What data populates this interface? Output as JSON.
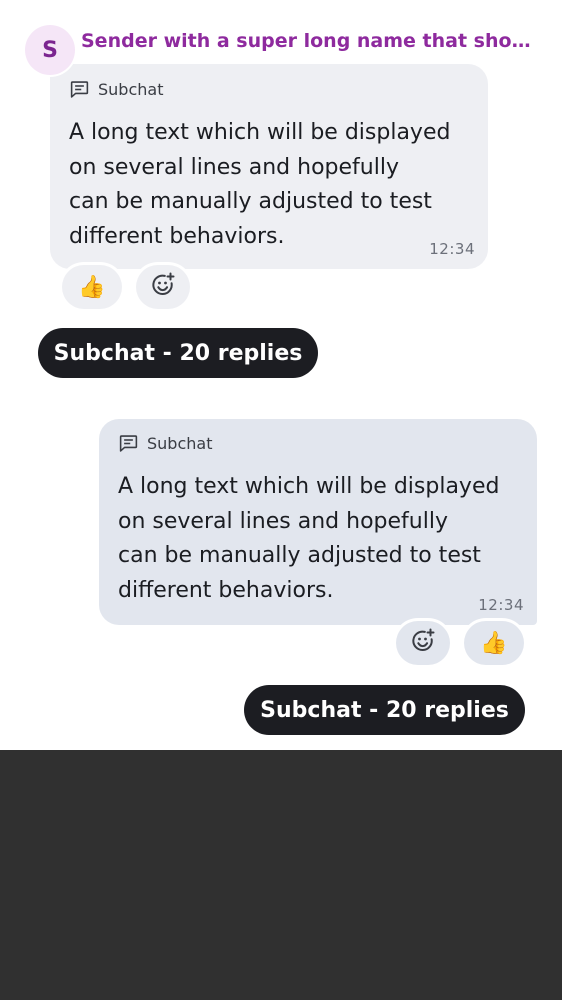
{
  "incoming": {
    "avatar_letter": "S",
    "sender_name": "Sender with a super long name that should overflow the available width",
    "thread_label": "Subchat",
    "text": "A long text which will be displayed\non several lines and hopefully\ncan be manually adjusted to test\ndifferent behaviors.",
    "time": "12:34",
    "reaction_emoji": "👍",
    "add_reaction_icon": "add-reaction-icon",
    "subchat_summary": "Subchat - 20 replies"
  },
  "outgoing": {
    "thread_label": "Subchat",
    "text": "A long text which will be displayed\non several lines and hopefully\ncan be manually adjusted to test\ndifferent behaviors.",
    "time": "12:34",
    "reaction_emoji": "👍",
    "add_reaction_icon": "add-reaction-icon",
    "subchat_summary": "Subchat - 20 replies"
  },
  "colors": {
    "sender": "#8e2a9e",
    "incoming_bubble": "#eeeff3",
    "outgoing_bubble": "#e2e6ee",
    "pill": "#1c1d22",
    "bottom_area": "#303030"
  }
}
